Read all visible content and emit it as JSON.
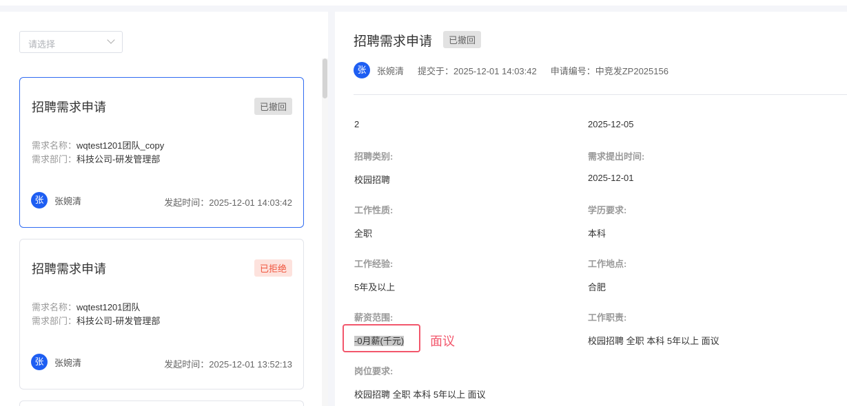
{
  "filter": {
    "placeholder": "请选择"
  },
  "cards": [
    {
      "title": "招聘需求申请",
      "status": "已撤回",
      "name_label": "需求名称：",
      "name": "wqtest1201团队_copy",
      "dept_label": "需求部门：",
      "dept": "科技公司-研发管理部",
      "avatar": "张",
      "user": "张婉清",
      "time_label": "发起时间：",
      "time": "2025-12-01 14:03:42"
    },
    {
      "title": "招聘需求申请",
      "status": "已拒绝",
      "name_label": "需求名称：",
      "name": "wqtest1201团队",
      "dept_label": "需求部门：",
      "dept": "科技公司-研发管理部",
      "avatar": "张",
      "user": "张婉清",
      "time_label": "发起时间：",
      "time": "2025-12-01 13:52:13"
    }
  ],
  "detail": {
    "title": "招聘需求申请",
    "status": "已撤回",
    "avatar": "张",
    "user": "张婉清",
    "submitted": "提交于：2025-12-01 14:03:42",
    "code": "申请编号：中竞发ZP2025156",
    "top_left": "2",
    "top_right": "2025-12-05",
    "fields": [
      {
        "label": "招聘类别:",
        "value": "校园招聘"
      },
      {
        "label": "需求提出时间:",
        "value": "2025-12-01"
      },
      {
        "label": "工作性质:",
        "value": "全职"
      },
      {
        "label": "学历要求:",
        "value": "本科"
      },
      {
        "label": "工作经验:",
        "value": "5年及以上"
      },
      {
        "label": "工作地点:",
        "value": "合肥"
      },
      {
        "label": "薪资范围:",
        "value": "-0月薪(千元)"
      },
      {
        "label": "工作职责:",
        "value": "校园招聘 全职 本科 5年以上 面议"
      },
      {
        "label": "岗位要求:",
        "value": "校园招聘 全职 本科 5年以上 面议"
      }
    ],
    "annotation": "面议"
  }
}
